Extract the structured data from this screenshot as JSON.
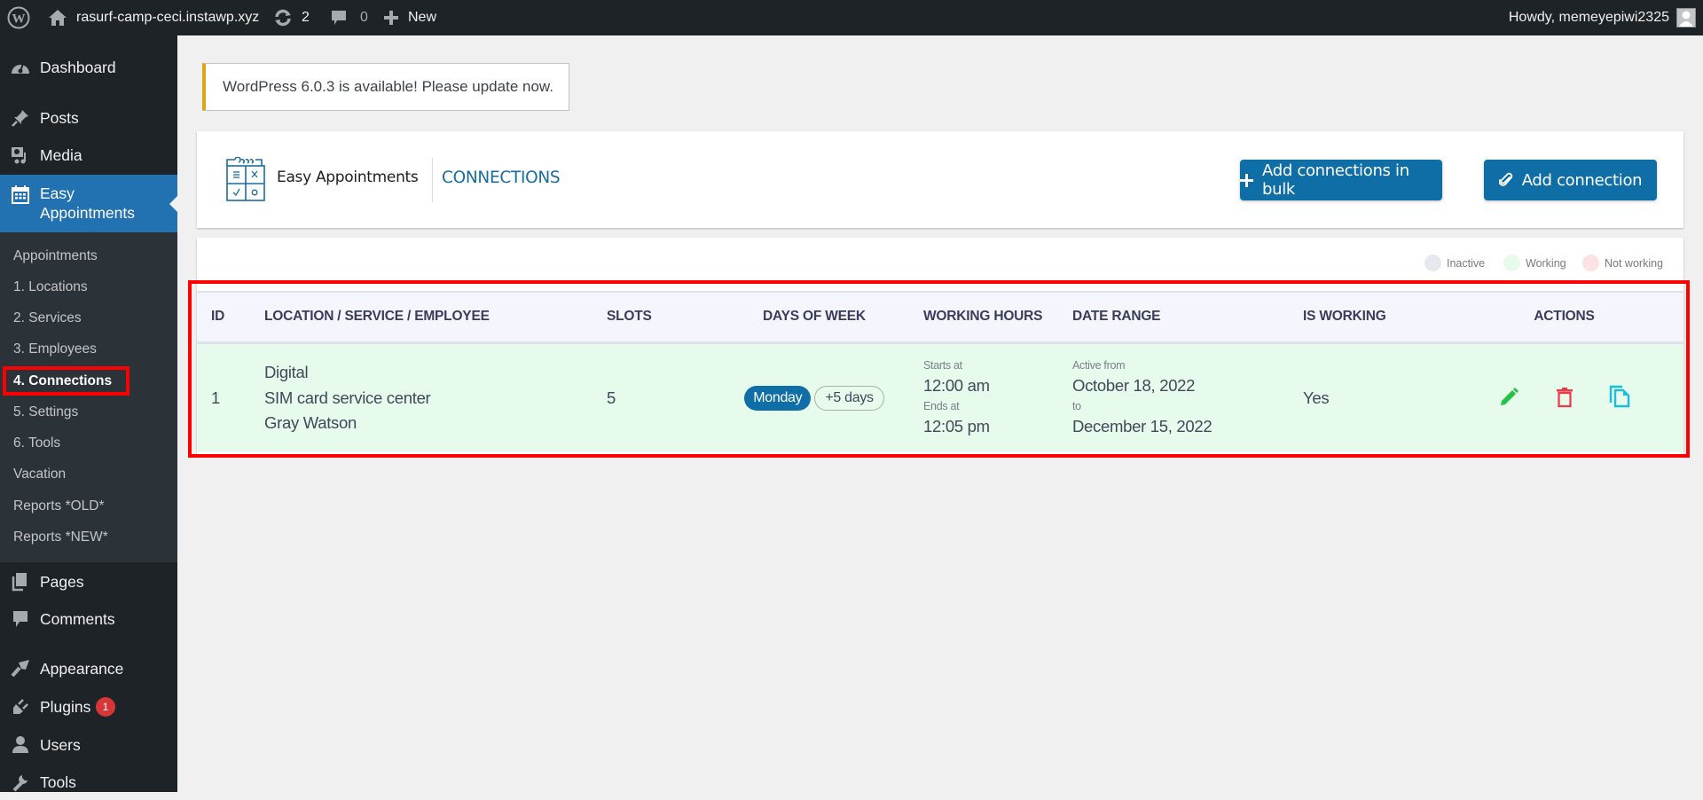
{
  "adminbar": {
    "site_name": "rasurf-camp-ceci.instawp.xyz",
    "updates_count": "2",
    "comments_count": "0",
    "new_label": "New",
    "howdy": "Howdy, memeyepiwi2325",
    "icons": {
      "wp_logo": "wordpress-logo-icon",
      "home": "home-icon",
      "updates": "refresh-icon",
      "comments": "comment-bubble-icon",
      "new": "plus-icon",
      "avatar": "user-avatar-icon"
    }
  },
  "sidebar": {
    "items": [
      {
        "label": "Dashboard",
        "icon": "dashboard-gauge-icon"
      },
      {
        "label": "Posts",
        "icon": "pushpin-icon"
      },
      {
        "label": "Media",
        "icon": "media-icon"
      },
      {
        "label": "Easy\nAppointments",
        "label_line1": "Easy",
        "label_line2": "Appointments",
        "icon": "calendar-icon",
        "active": true
      },
      {
        "label": "Pages",
        "icon": "pages-icon"
      },
      {
        "label": "Comments",
        "icon": "comment-icon"
      },
      {
        "label": "Appearance",
        "icon": "paintbrush-icon"
      },
      {
        "label": "Plugins",
        "icon": "plug-icon",
        "badge": "1"
      },
      {
        "label": "Users",
        "icon": "user-icon"
      },
      {
        "label": "Tools",
        "icon": "wrench-icon"
      }
    ],
    "submenu": [
      {
        "label": "Appointments"
      },
      {
        "label": "1. Locations"
      },
      {
        "label": "2. Services"
      },
      {
        "label": "3. Employees"
      },
      {
        "label": "4. Connections",
        "current": true
      },
      {
        "label": "5. Settings"
      },
      {
        "label": "6. Tools"
      },
      {
        "label": "Vacation"
      },
      {
        "label": "Reports *OLD*"
      },
      {
        "label": "Reports *NEW*"
      }
    ]
  },
  "notice": {
    "text": "WordPress 6.0.3 is available! Please update now."
  },
  "header": {
    "plugin_name": "Easy Appointments",
    "page_title": "CONNECTIONS",
    "add_bulk_label": "Add connections in bulk",
    "add_connection_label": "Add connection"
  },
  "legend": [
    {
      "label": "Inactive",
      "color": "#e6e8ee"
    },
    {
      "label": "Working",
      "color": "#e6fbec"
    },
    {
      "label": "Not working",
      "color": "#fde2e4"
    }
  ],
  "table": {
    "columns": [
      "ID",
      "LOCATION / SERVICE / EMPLOYEE",
      "SLOTS",
      "DAYS OF WEEK",
      "WORKING HOURS",
      "DATE RANGE",
      "IS WORKING",
      "ACTIONS"
    ],
    "rows": [
      {
        "id": "1",
        "location": "Digital",
        "service": "SIM card service center",
        "employee": "Gray Watson",
        "slots": "5",
        "day": "Monday",
        "extra_days": "+5 days",
        "starts_label": "Starts at",
        "starts": "12:00 am",
        "ends_label": "Ends at",
        "ends": "12:05 pm",
        "active_from_label": "Active from",
        "active_from": "October 18, 2022",
        "to_label": "to",
        "active_to": "December 15, 2022",
        "is_working": "Yes",
        "status": "working"
      }
    ]
  },
  "colors": {
    "adminbar_bg": "#1d2327",
    "sidebar_active": "#2271b1",
    "primary_button": "#0f6ea6",
    "highlight": "#ff0000",
    "edit_icon": "#22c245",
    "delete_icon": "#f0374a",
    "copy_icon": "#1cbcdc"
  }
}
